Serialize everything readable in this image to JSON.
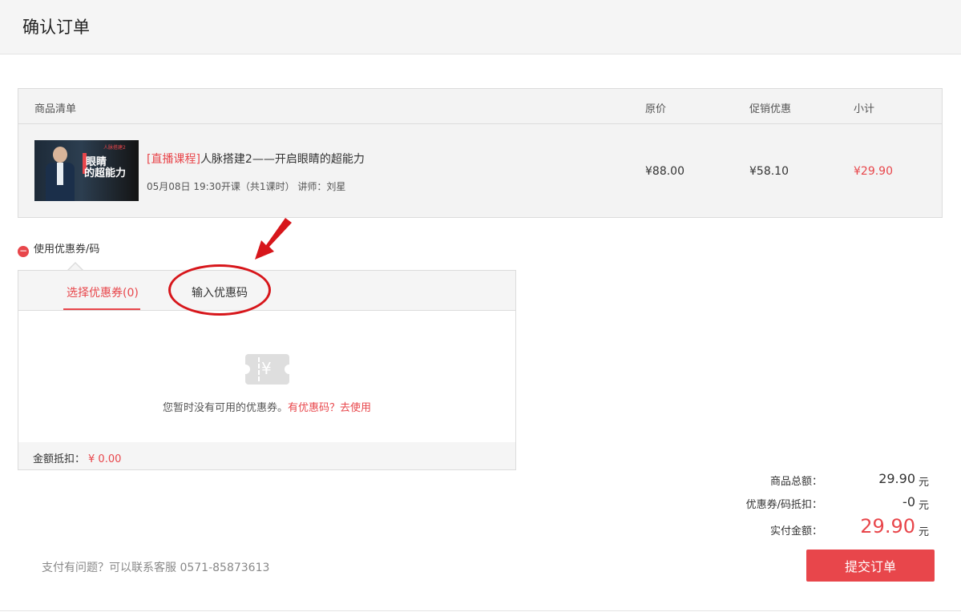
{
  "header": {
    "title": "确认订单"
  },
  "table": {
    "headers": [
      "商品清单",
      "原价",
      "促销优惠",
      "小计"
    ],
    "product": {
      "thumb_tag": "人脉搭建2",
      "thumb_line1": "眼睛",
      "thumb_line2": "的超能力",
      "course_tag": "[直播课程]",
      "name": "人脉搭建2——开启眼睛的超能力",
      "meta": "05月08日 19:30开课（共1课时）   讲师：刘星",
      "original_price": "¥88.00",
      "promo": "¥58.10",
      "subtotal": "¥29.90"
    }
  },
  "coupon": {
    "toggle_icon": "minus-circle-icon",
    "toggle_label": "使用优惠券/码",
    "tabs": [
      "选择优惠券(0)",
      "输入优惠码"
    ],
    "active_tab": 0,
    "empty_text": "您暂时没有可用的优惠券。",
    "empty_link": "有优惠码？去使用",
    "ticket_symbol": "¥",
    "discount_label": "金额抵扣：",
    "discount_value": "¥ 0.00"
  },
  "summary": {
    "total_label": "商品总额：",
    "total_value": "29.90",
    "coupon_label": "优惠券/码抵扣：",
    "coupon_value": "-0",
    "pay_label": "实付金额：",
    "pay_value": "29.90",
    "unit": "元"
  },
  "footer": {
    "help": "支付有问题？可以联系客服 0571-85873613",
    "submit": "提交订单"
  },
  "colors": {
    "accent": "#e8464b",
    "annotation": "#d7161b"
  }
}
